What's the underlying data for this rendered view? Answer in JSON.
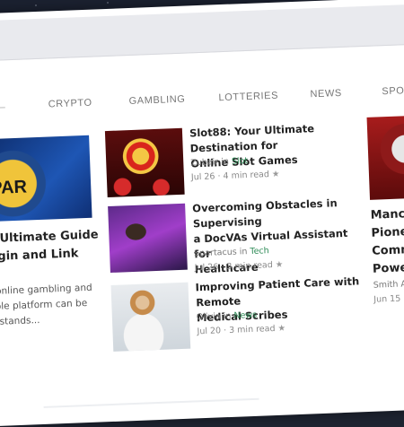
{
  "browser": {
    "url_text": "m"
  },
  "nav": {
    "items": [
      "CRYPTO",
      "GAMBLING",
      "LOTTERIES",
      "NEWS",
      "SPORT"
    ]
  },
  "featured": {
    "image_text": "PAR",
    "title_lines": [
      "ur Ultimate Guide",
      "Login and Link"
    ],
    "excerpt_lines": [
      "of online gambling and",
      "liable platform can be",
      "55 stands..."
    ]
  },
  "posts": [
    {
      "title_lines": [
        "Slot88: Your Ultimate Destination for",
        "Online Slot Games"
      ],
      "author": "Zubair",
      "in": "in",
      "category": "Slot",
      "date": "Jul 26 · 4 min read",
      "icon": "star-icon"
    },
    {
      "title_lines": [
        "Overcoming Obstacles in Supervising",
        "a DocVAs Virtual Assistant for",
        "Healthcare"
      ],
      "author": "Spartacus",
      "in": "in",
      "category": "Tech",
      "date": "Jul 26 · 3 min read",
      "icon": "star-icon"
    },
    {
      "title_lines": [
        "Improving Patient Care with Remote",
        "Medical Scribes"
      ],
      "author": "Olivia",
      "in": "in",
      "category": "News",
      "date": "Jul 20 · 3 min read",
      "icon": "star-icon"
    }
  ],
  "right_post": {
    "title_lines": [
      "Manch",
      "Pione",
      "Comm",
      "Powe"
    ],
    "author": "Smith A",
    "date": "Jun 15 ·"
  },
  "colors": {
    "category": "#2e8b57",
    "logo": "#c7371f"
  }
}
